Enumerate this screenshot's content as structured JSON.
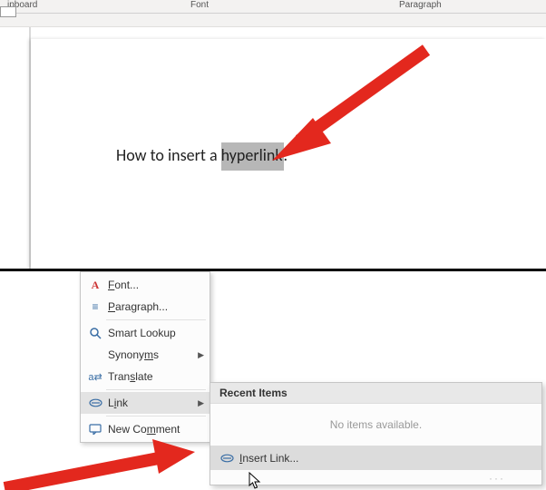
{
  "ribbon": {
    "group_clipboard": "ipboard",
    "group_font": "Font",
    "group_paragraph": "Paragraph"
  },
  "document": {
    "text_prefix": "How to insert a ",
    "text_highlight": "hyperlink",
    "text_period": "."
  },
  "context_menu": {
    "items": [
      {
        "label": "Font...",
        "icon": "A"
      },
      {
        "label": "Paragraph...",
        "icon": "¶"
      },
      {
        "label": "Smart Lookup",
        "icon": "🔍"
      },
      {
        "label": "Synonyms",
        "icon": "",
        "has_submenu": true
      },
      {
        "label": "Translate",
        "icon": "🔤"
      },
      {
        "label": "Link",
        "icon": "🔗",
        "has_submenu": true,
        "hovered": true
      },
      {
        "label": "New Comment",
        "icon": "💬"
      }
    ]
  },
  "submenu": {
    "header": "Recent Items",
    "empty_text": "No items available.",
    "insert_label": "Insert Link...",
    "insert_icon": "🔗"
  }
}
